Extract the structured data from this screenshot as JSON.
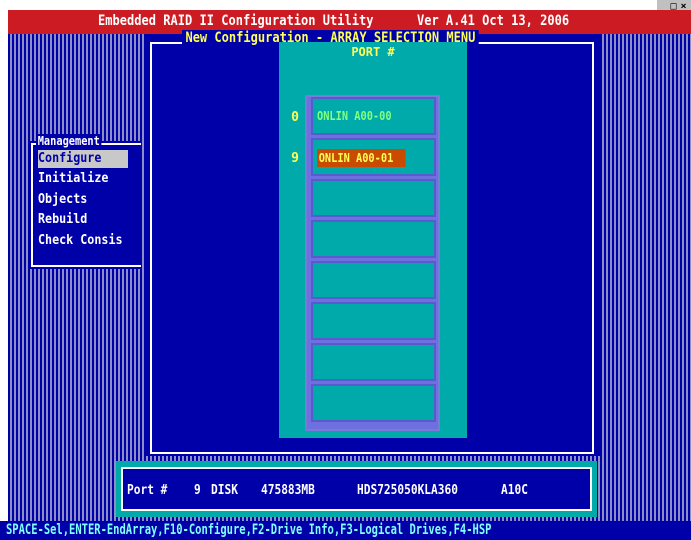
{
  "window": {
    "controls": [
      "_",
      "□",
      "×"
    ]
  },
  "title_bar": {
    "text": "Embedded RAID II Configuration Utility      Ver A.41 Oct 13, 2006"
  },
  "dialog": {
    "title": "New Configuration - ARRAY SELECTION MENU"
  },
  "port_panel": {
    "header": "PORT #",
    "slots": [
      {
        "number": "0",
        "label": "ONLIN A00-00",
        "selected": false
      },
      {
        "number": "9",
        "label": "ONLIN A00-01",
        "selected": true
      },
      {
        "number": "",
        "label": "",
        "selected": false
      },
      {
        "number": "",
        "label": "",
        "selected": false
      },
      {
        "number": "",
        "label": "",
        "selected": false
      },
      {
        "number": "",
        "label": "",
        "selected": false
      },
      {
        "number": "",
        "label": "",
        "selected": false
      },
      {
        "number": "",
        "label": "",
        "selected": false
      }
    ]
  },
  "management_menu": {
    "title": "Management",
    "items": [
      {
        "label": "Configure",
        "selected": true
      },
      {
        "label": "Initialize",
        "selected": false
      },
      {
        "label": "Objects",
        "selected": false
      },
      {
        "label": "Rebuild",
        "selected": false
      },
      {
        "label": "Check Consis",
        "selected": false
      }
    ]
  },
  "info_bar": {
    "port_label": "Port #",
    "port_number": "9",
    "type": "DISK",
    "size": "475883MB",
    "model": "HDS725050KLA360",
    "firmware": "A10C"
  },
  "help_bar": {
    "text": "SPACE-Sel,ENTER-EndArray,F10-Configure,F2-Drive Info,F3-Logical Drives,F4-HSP"
  },
  "colors": {
    "title_bg": "#cc1b22",
    "dialog_bg": "#0000a8",
    "panel_bg": "#00aaaa",
    "selected_bg": "#c84b00",
    "highlight_text": "#ffff55",
    "online_text": "#80ff80"
  }
}
